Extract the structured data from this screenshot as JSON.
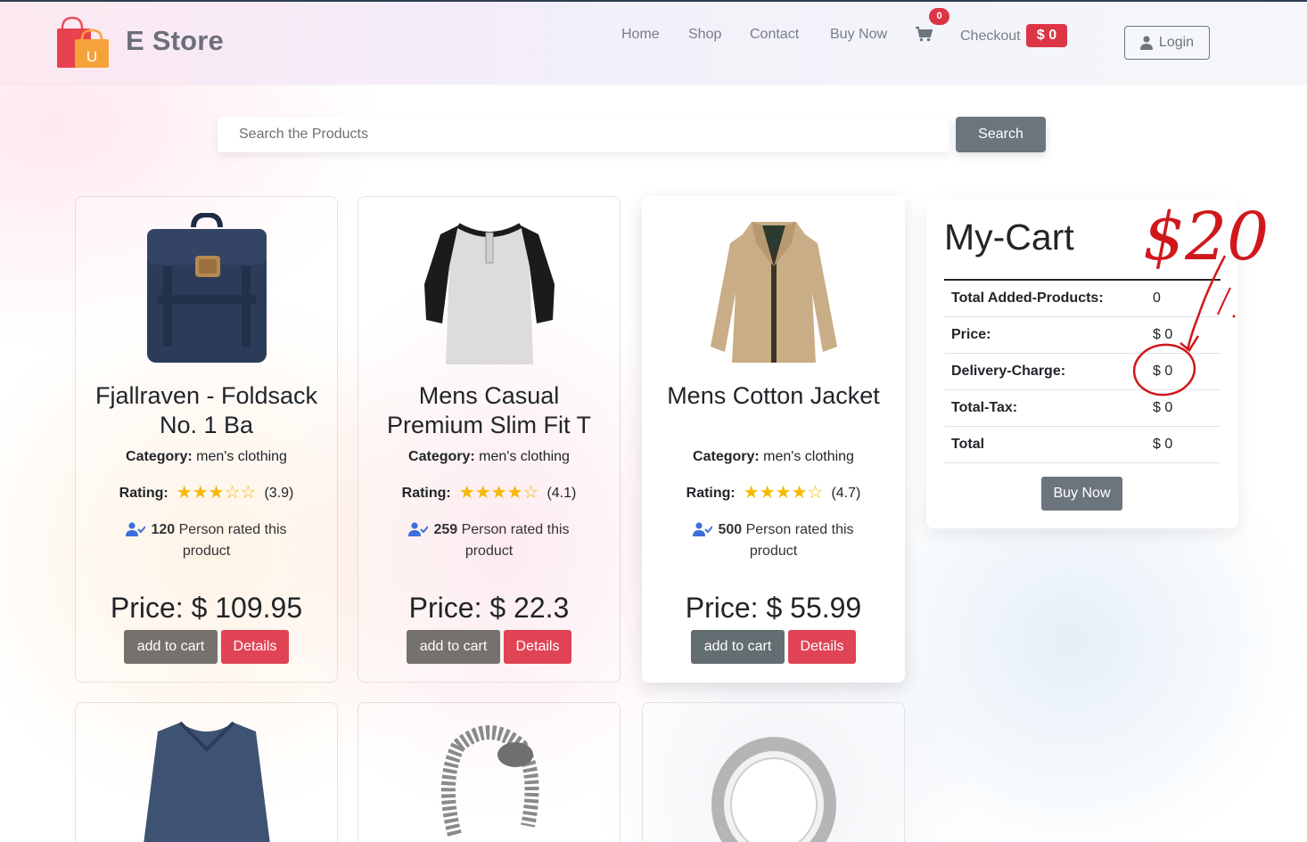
{
  "navbar": {
    "brand": "E Store",
    "logo_letter": "U",
    "links": [
      "Home",
      "Shop",
      "Contact",
      "Buy Now"
    ],
    "cart_count": "0",
    "checkout_label": "Checkout",
    "checkout_amount": "$ 0",
    "login_label": "Login"
  },
  "search": {
    "placeholder": "Search the Products",
    "button_label": "Search"
  },
  "products": [
    {
      "image_icon": "backpack",
      "title": "Fjallraven - Foldsack No. 1 Ba",
      "category_label": "Category:",
      "category": "men's clothing",
      "rating_label": "Rating:",
      "rating": 3.9,
      "rating_text": "(3.9)",
      "rated_count": "120",
      "rated_text": "Person rated this product",
      "price": "Price: $ 109.95",
      "add_label": "add to cart",
      "details_label": "Details"
    },
    {
      "image_icon": "raglan-tshirt",
      "title": "Mens Casual Premium Slim Fit T",
      "category_label": "Category:",
      "category": "men's clothing",
      "rating_label": "Rating:",
      "rating": 4.1,
      "rating_text": "(4.1)",
      "rated_count": "259",
      "rated_text": "Person rated this product",
      "price": "Price: $ 22.3",
      "add_label": "add to cart",
      "details_label": "Details"
    },
    {
      "image_icon": "jacket",
      "title": "Mens Cotton Jacket",
      "category_label": "Category:",
      "category": "men's clothing",
      "rating_label": "Rating:",
      "rating": 4.7,
      "rating_text": "(4.7)",
      "rated_count": "500",
      "rated_text": "Person rated this product",
      "price": "Price: $ 55.99",
      "add_label": "add to cart",
      "details_label": "Details"
    }
  ],
  "products_row2": [
    {
      "image_icon": "long-sleeve-shirt"
    },
    {
      "image_icon": "dragon-bracelet"
    },
    {
      "image_icon": "silver-ring"
    }
  ],
  "cart": {
    "title": "My-Cart",
    "rows": [
      {
        "label": "Total Added-Products:",
        "value": "0"
      },
      {
        "label": "Price:",
        "value": "$ 0"
      },
      {
        "label": "Delivery-Charge:",
        "value": "$ 0"
      },
      {
        "label": "Total-Tax:",
        "value": "$ 0"
      },
      {
        "label": "Total",
        "value": "$ 0"
      }
    ],
    "buy_label": "Buy Now"
  },
  "annotation": {
    "text": "$20",
    "color": "#d0181c"
  },
  "colors": {
    "danger": "#dc3545",
    "secondary": "#6c757d",
    "star": "#f6b800",
    "user_icon": "#3d6fd9"
  }
}
